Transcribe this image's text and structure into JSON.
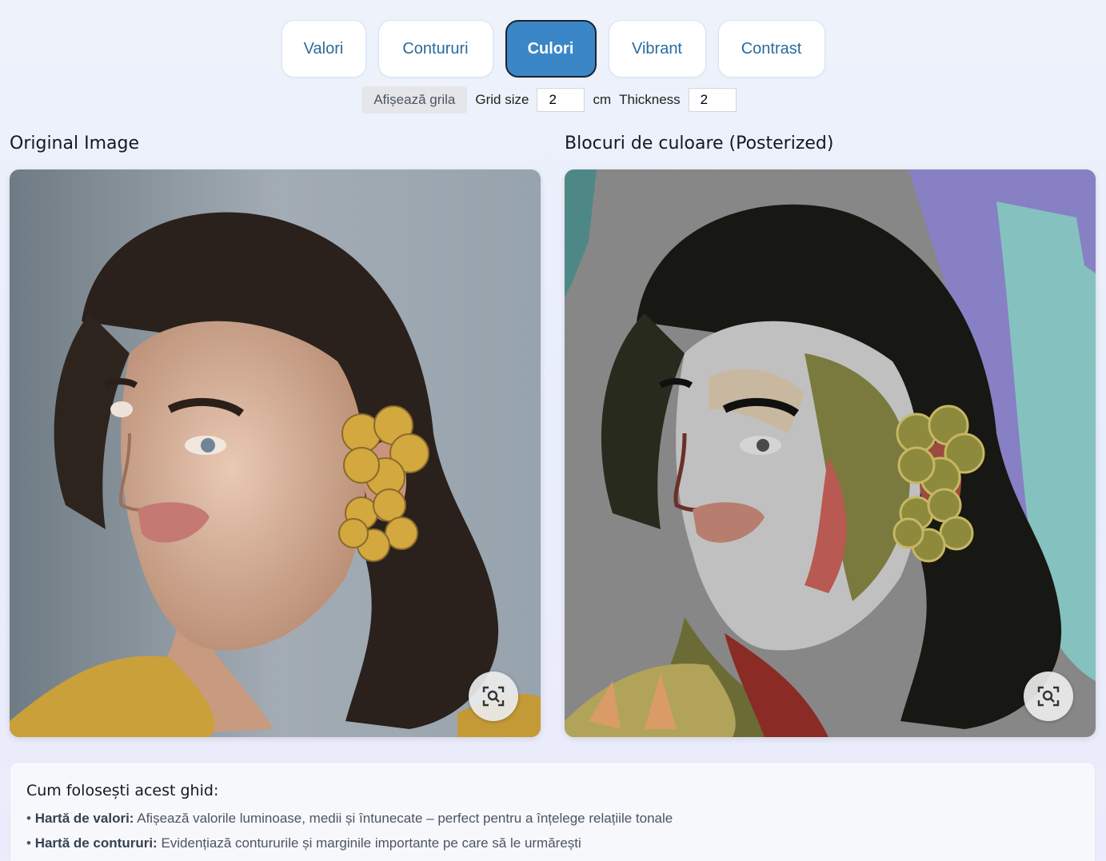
{
  "tabs": [
    {
      "label": "Valori",
      "active": false
    },
    {
      "label": "Contururi",
      "active": false
    },
    {
      "label": "Culori",
      "active": true
    },
    {
      "label": "Vibrant",
      "active": false
    },
    {
      "label": "Contrast",
      "active": false
    }
  ],
  "controls": {
    "grid_button": "Afișează grila",
    "grid_size_label": "Grid size",
    "grid_size_value": "2",
    "grid_unit": "cm",
    "thickness_label": "Thickness",
    "thickness_value": "2"
  },
  "panels": {
    "left_title": "Original Image",
    "right_title": "Blocuri de culoare (Posterized)",
    "zoom_icon": "zoom-scan-icon"
  },
  "guide": {
    "title": "Cum folosești acest ghid:",
    "items": [
      {
        "bold": "Hartă de valori:",
        "text": " Afișează valorile luminoase, medii și întunecate – perfect pentru a înțelege relațiile tonale"
      },
      {
        "bold": "Hartă de contururi:",
        "text": " Evidențiază contururile și marginile importante pe care să le urmărești"
      }
    ]
  },
  "colors": {
    "accent": "#3b86c6",
    "tab_text": "#2b6a9c"
  }
}
